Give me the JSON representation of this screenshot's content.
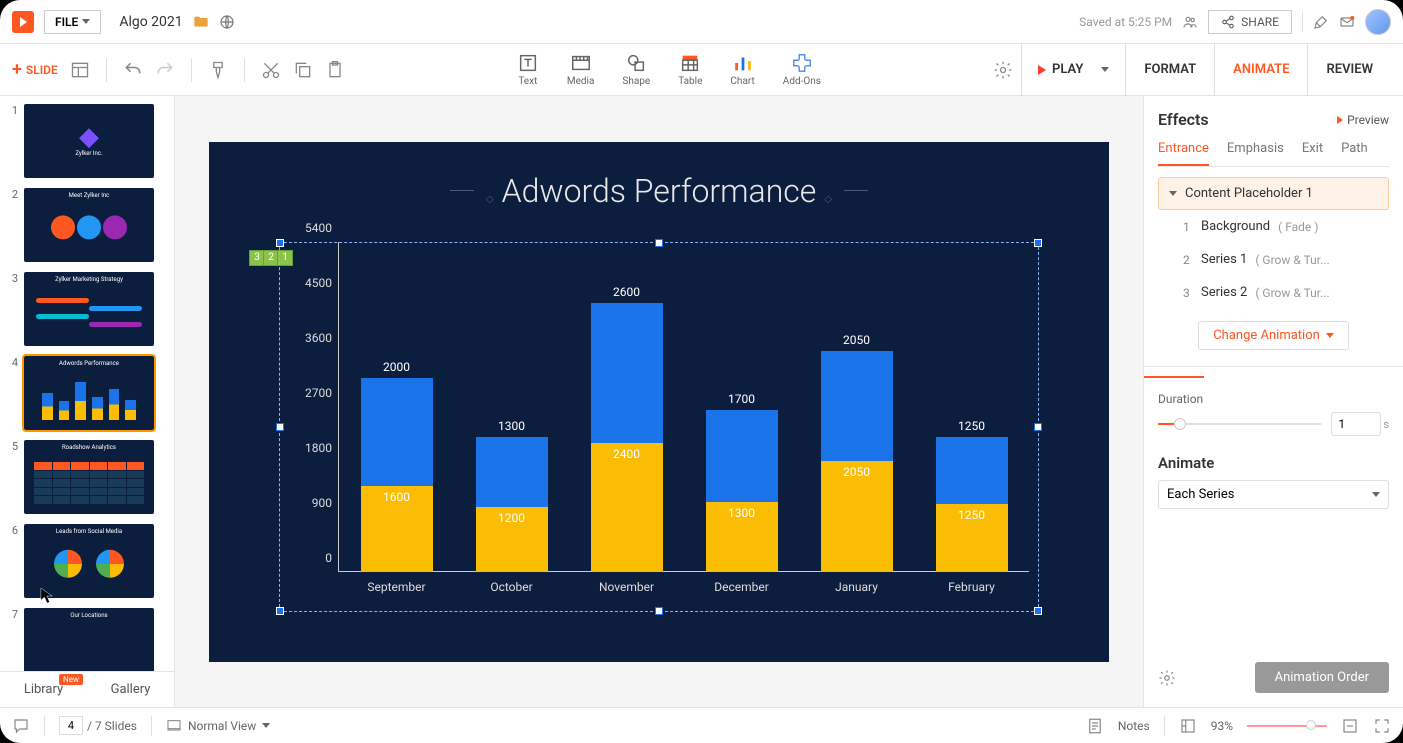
{
  "topbar": {
    "file_label": "FILE",
    "doc_name": "Algo 2021",
    "saved_text": "Saved at 5:25 PM",
    "share_label": "SHARE"
  },
  "ribbon": {
    "add_slide": "SLIDE",
    "tools": {
      "text": "Text",
      "media": "Media",
      "shape": "Shape",
      "table": "Table",
      "chart": "Chart",
      "addons": "Add-Ons"
    },
    "play": "PLAY",
    "format": "FORMAT",
    "animate": "ANIMATE",
    "review": "REVIEW"
  },
  "slides": {
    "thumbs": [
      {
        "num": "1",
        "caption": "Zylker Inc."
      },
      {
        "num": "2",
        "caption": "Meet Zylker Inc"
      },
      {
        "num": "3",
        "caption": "Zylker Marketing Strategy"
      },
      {
        "num": "4",
        "caption": "Adwords Performance"
      },
      {
        "num": "5",
        "caption": "Roadshow Analytics"
      },
      {
        "num": "6",
        "caption": "Leads from Social Media"
      },
      {
        "num": "7",
        "caption": "Our Locations"
      }
    ],
    "tabs": {
      "library": "Library",
      "gallery": "Gallery",
      "new_badge": "New"
    }
  },
  "canvas": {
    "title": "Adwords Performance",
    "anim_tags": [
      "3",
      "2",
      "1"
    ]
  },
  "chart_data": {
    "type": "bar",
    "stacked": true,
    "title": "Adwords Performance",
    "categories": [
      "September",
      "October",
      "November",
      "December",
      "January",
      "February"
    ],
    "series": [
      {
        "name": "Series 1",
        "color": "#fbbc04",
        "values": [
          1600,
          1200,
          2400,
          1300,
          2050,
          1250
        ]
      },
      {
        "name": "Series 2",
        "color": "#1a73e8",
        "values": [
          2000,
          1300,
          2600,
          1700,
          2050,
          1250
        ]
      }
    ],
    "y_ticks": [
      0,
      900,
      1800,
      2700,
      3600,
      4500,
      5400
    ],
    "ylim": [
      0,
      5400
    ],
    "xlabel": "",
    "ylabel": ""
  },
  "panel": {
    "title": "Effects",
    "preview": "Preview",
    "tabs": {
      "entrance": "Entrance",
      "emphasis": "Emphasis",
      "exit": "Exit",
      "path": "Path"
    },
    "items": [
      {
        "num": "",
        "name": "Content Placeholder 1",
        "effect": "",
        "expanded": true
      },
      {
        "num": "1",
        "name": "Background",
        "effect": "( Fade )"
      },
      {
        "num": "2",
        "name": "Series 1",
        "effect": "( Grow & Tur..."
      },
      {
        "num": "3",
        "name": "Series 2",
        "effect": "( Grow & Tur..."
      }
    ],
    "change_anim": "Change Animation",
    "duration_label": "Duration",
    "duration_value": "1",
    "duration_unit": "s",
    "animate_label": "Animate",
    "animate_value": "Each Series",
    "anim_order": "Animation Order"
  },
  "status": {
    "current_slide": "4",
    "total_slides": "/ 7 Slides",
    "view": "Normal View",
    "notes": "Notes",
    "zoom": "93%"
  }
}
